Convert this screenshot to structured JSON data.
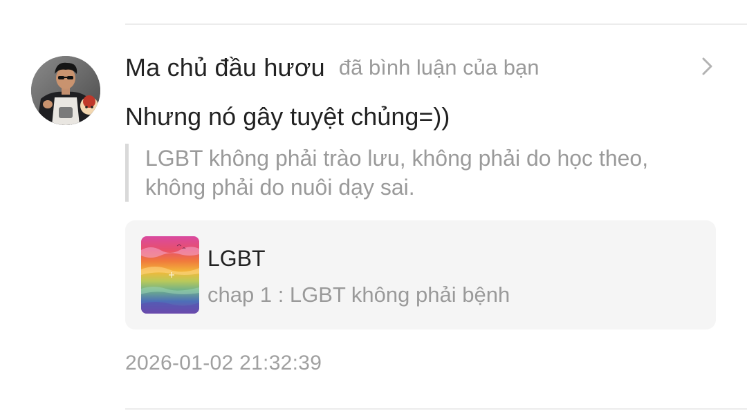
{
  "notification": {
    "user": {
      "name": "Ma chủ đầu hươu",
      "avatar_icon": "user-avatar"
    },
    "action_text": "đã bình luận của bạn",
    "chevron_icon": "chevron-right-icon",
    "comment": "Nhưng nó gây tuyệt chủng=))",
    "quoted_comment": {
      "line1": "LGBT không phải trào lưu, không phải do học theo,",
      "line2": "không phải do nuôi dạy sai."
    },
    "story": {
      "title": "LGBT",
      "chapter": "chap 1 : LGBT không phải bệnh",
      "cover_icon": "rainbow-cover-image"
    },
    "timestamp": "2026-01-02 21:32:39"
  },
  "colors": {
    "primary_text": "#222222",
    "secondary_text": "#9a9a9a",
    "card_background": "#f5f5f5",
    "quote_bar": "#d9d9d9",
    "divider": "#ececec"
  }
}
